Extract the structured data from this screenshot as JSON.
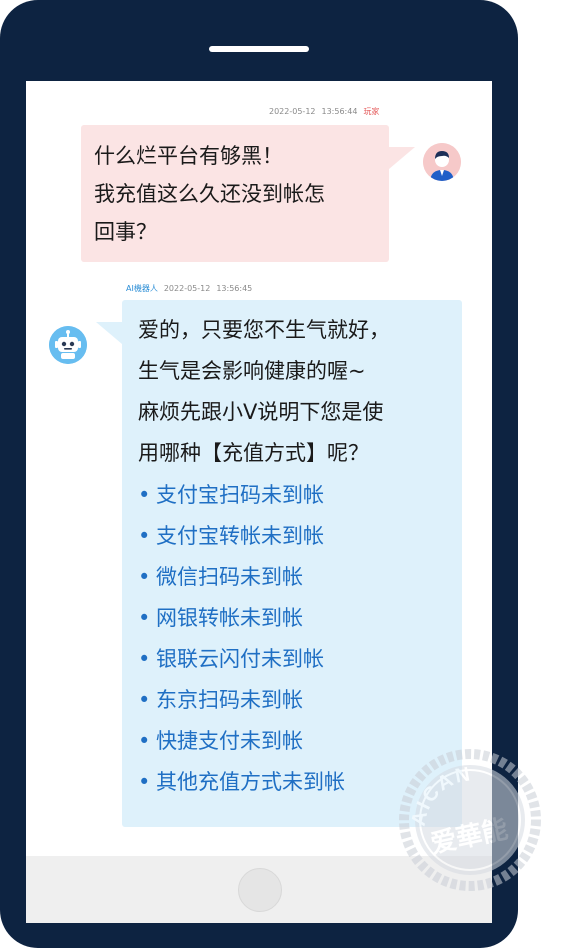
{
  "user_message": {
    "date": "2022-05-12",
    "time": "13:56:44",
    "sender_label": "玩家",
    "lines": [
      "什么烂平台有够黑！",
      "我充值这么久还没到帐怎",
      "回事？"
    ]
  },
  "bot_message": {
    "sender_label": "AI機器人",
    "date": "2022-05-12",
    "time": "13:56:45",
    "lines": [
      "爱的，只要您不生气就好，",
      "生气是会影响健康的喔~",
      "麻烦先跟小V说明下您是使",
      "用哪种【充值方式】呢？"
    ],
    "options": [
      "支付宝扫码未到帐",
      "支付宝转帐未到帐",
      "微信扫码未到帐",
      "网银转帐未到帐",
      "银联云闪付未到帐",
      "东京扫码未到帐",
      "快捷支付未到帐",
      "其他充值方式未到帐"
    ]
  },
  "watermark": {
    "top_text": "AICAN",
    "bottom_text": "爱華能"
  },
  "colors": {
    "phone_frame": "#0d2341",
    "user_bubble": "#fbe4e4",
    "bot_bubble": "#def1fb",
    "option_link": "#1f6fc4",
    "player_label": "#e45a5a",
    "bot_label": "#2e8fd6"
  },
  "icons": {
    "user_avatar": "user-avatar-icon",
    "bot_avatar": "robot-avatar-icon",
    "bullet": "•"
  }
}
